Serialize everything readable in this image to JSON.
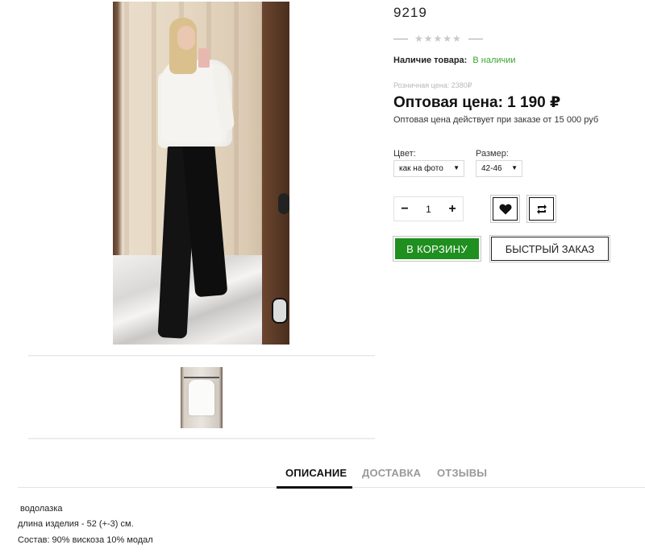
{
  "product": {
    "sku": "9219",
    "rating_stars": "★★★★★",
    "stock_label": "Наличие товара:",
    "stock_value": "В наличии",
    "retail_price": "Розничная цена: 2380₽",
    "wholesale_price": "Оптовая цена: 1 190 ₽",
    "wholesale_note": "Оптовая цена действует при заказе от 15 000 руб"
  },
  "options": {
    "color_label": "Цвет:",
    "color_value": "как на фото",
    "size_label": "Размер:",
    "size_value": "42-46"
  },
  "quantity": {
    "minus": "−",
    "value": "1",
    "plus": "+"
  },
  "actions": {
    "cart": "В КОРЗИНУ",
    "fast_order": "БЫСТРЫЙ ЗАКАЗ",
    "wishlist_icon": "heart-icon",
    "compare_icon": "compare-arrows-icon"
  },
  "tabs": [
    {
      "label": "ОПИСАНИЕ",
      "active": true
    },
    {
      "label": "ДОСТАВКА",
      "active": false
    },
    {
      "label": "ОТЗЫВЫ",
      "active": false
    }
  ],
  "description": [
    "водолазка",
    "длина изделия - 52 (+-3) см.",
    "Состав: 90% вискоза 10% модал"
  ],
  "colors": {
    "in_stock": "#3aa52f",
    "cart_button": "#1f8f1f"
  }
}
